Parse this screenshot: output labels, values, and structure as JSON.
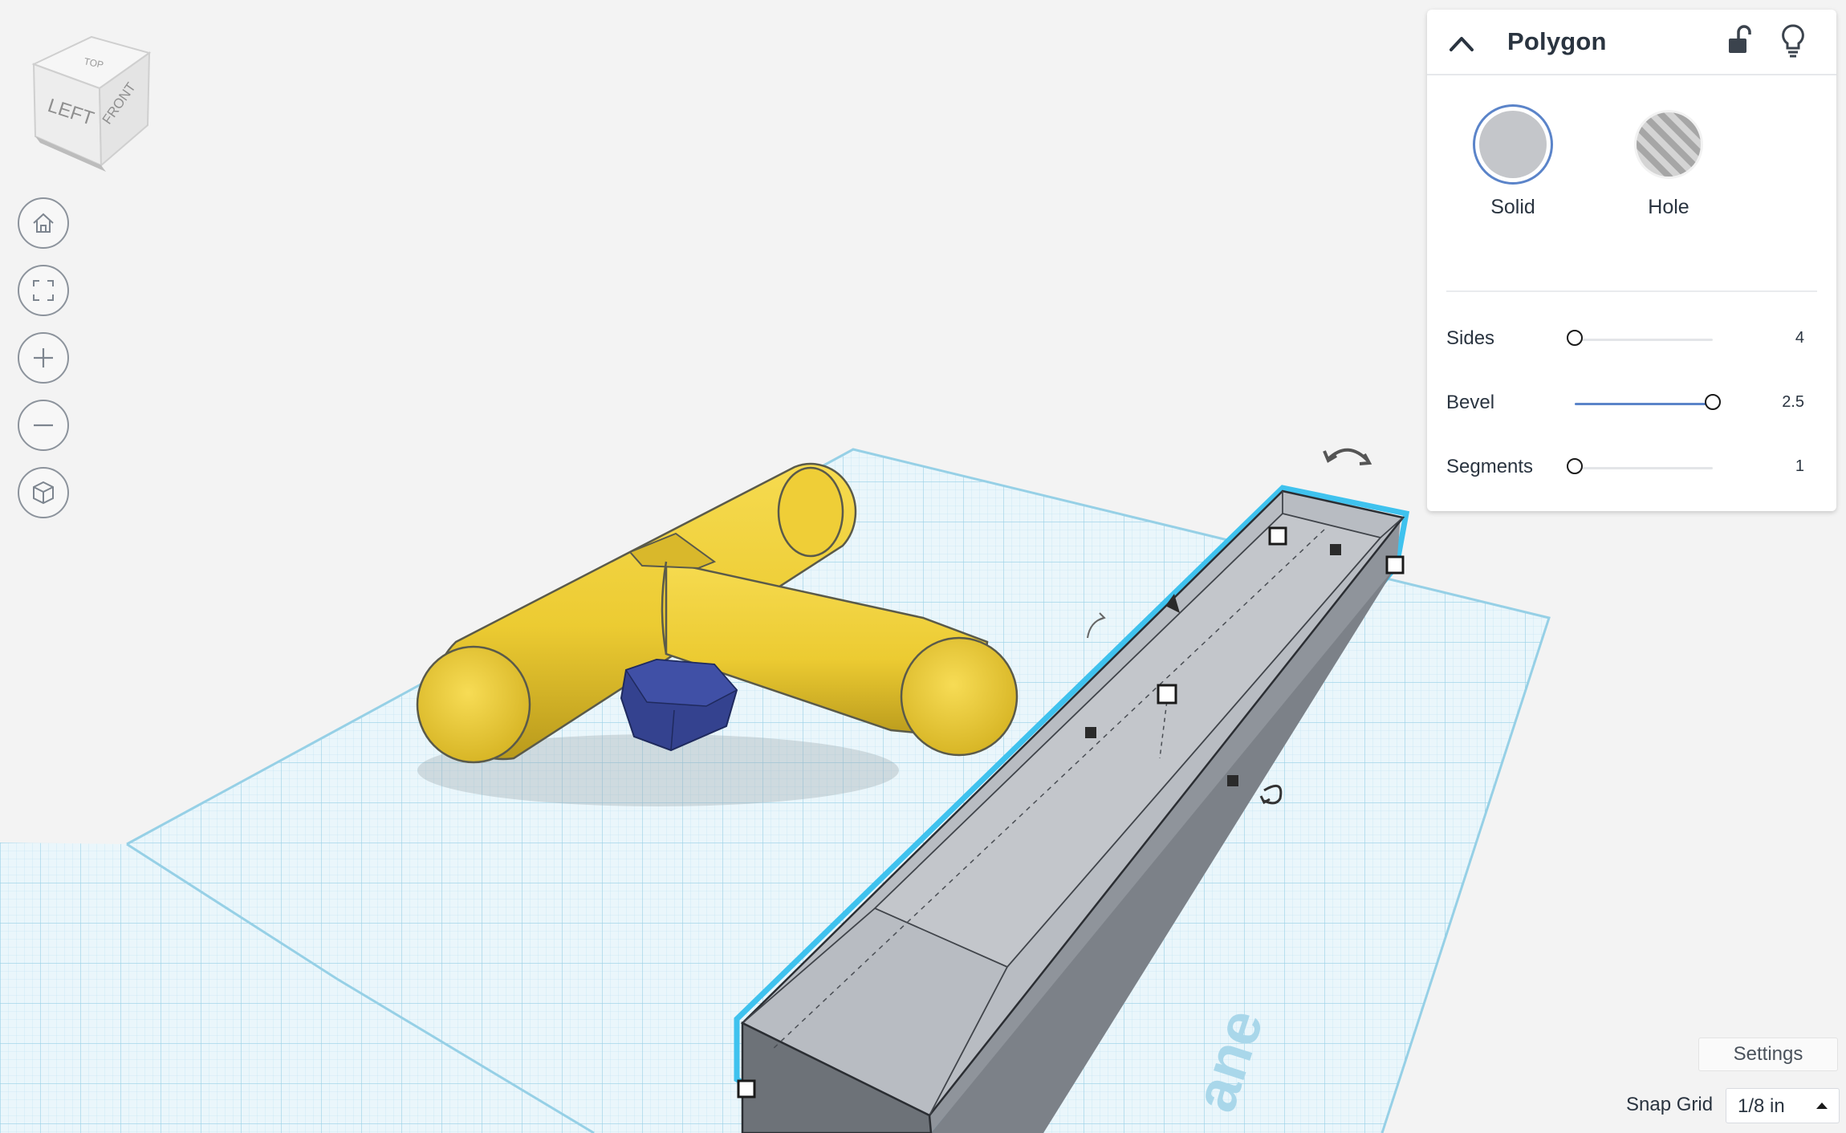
{
  "viewcube": {
    "left": "LEFT",
    "front": "FRONT",
    "top": "TOP"
  },
  "navigation": [
    {
      "name": "home-view",
      "icon": "home-icon"
    },
    {
      "name": "fit-all",
      "icon": "fit-view-icon"
    },
    {
      "name": "zoom-in",
      "icon": "plus-icon"
    },
    {
      "name": "zoom-out",
      "icon": "minus-icon"
    },
    {
      "name": "perspective-toggle",
      "icon": "cube-icon"
    }
  ],
  "inspector": {
    "title": "Polygon",
    "modes": {
      "solid": "Solid",
      "hole": "Hole"
    },
    "params": [
      {
        "label": "Sides",
        "value": "4",
        "fraction": 0.0
      },
      {
        "label": "Bevel",
        "value": "2.5",
        "fraction": 1.0
      },
      {
        "label": "Segments",
        "value": "1",
        "fraction": 0.0
      }
    ]
  },
  "workplane_watermark": "ane",
  "settings_label": "Settings",
  "snap_grid": {
    "label": "Snap Grid",
    "value": "1/8 in"
  },
  "colors": {
    "accent": "#5b84c9",
    "selection": "#3fc2ee",
    "yellow": "#f2d23c",
    "navy": "#2f3f8c",
    "grid": "#c8e6f2"
  }
}
